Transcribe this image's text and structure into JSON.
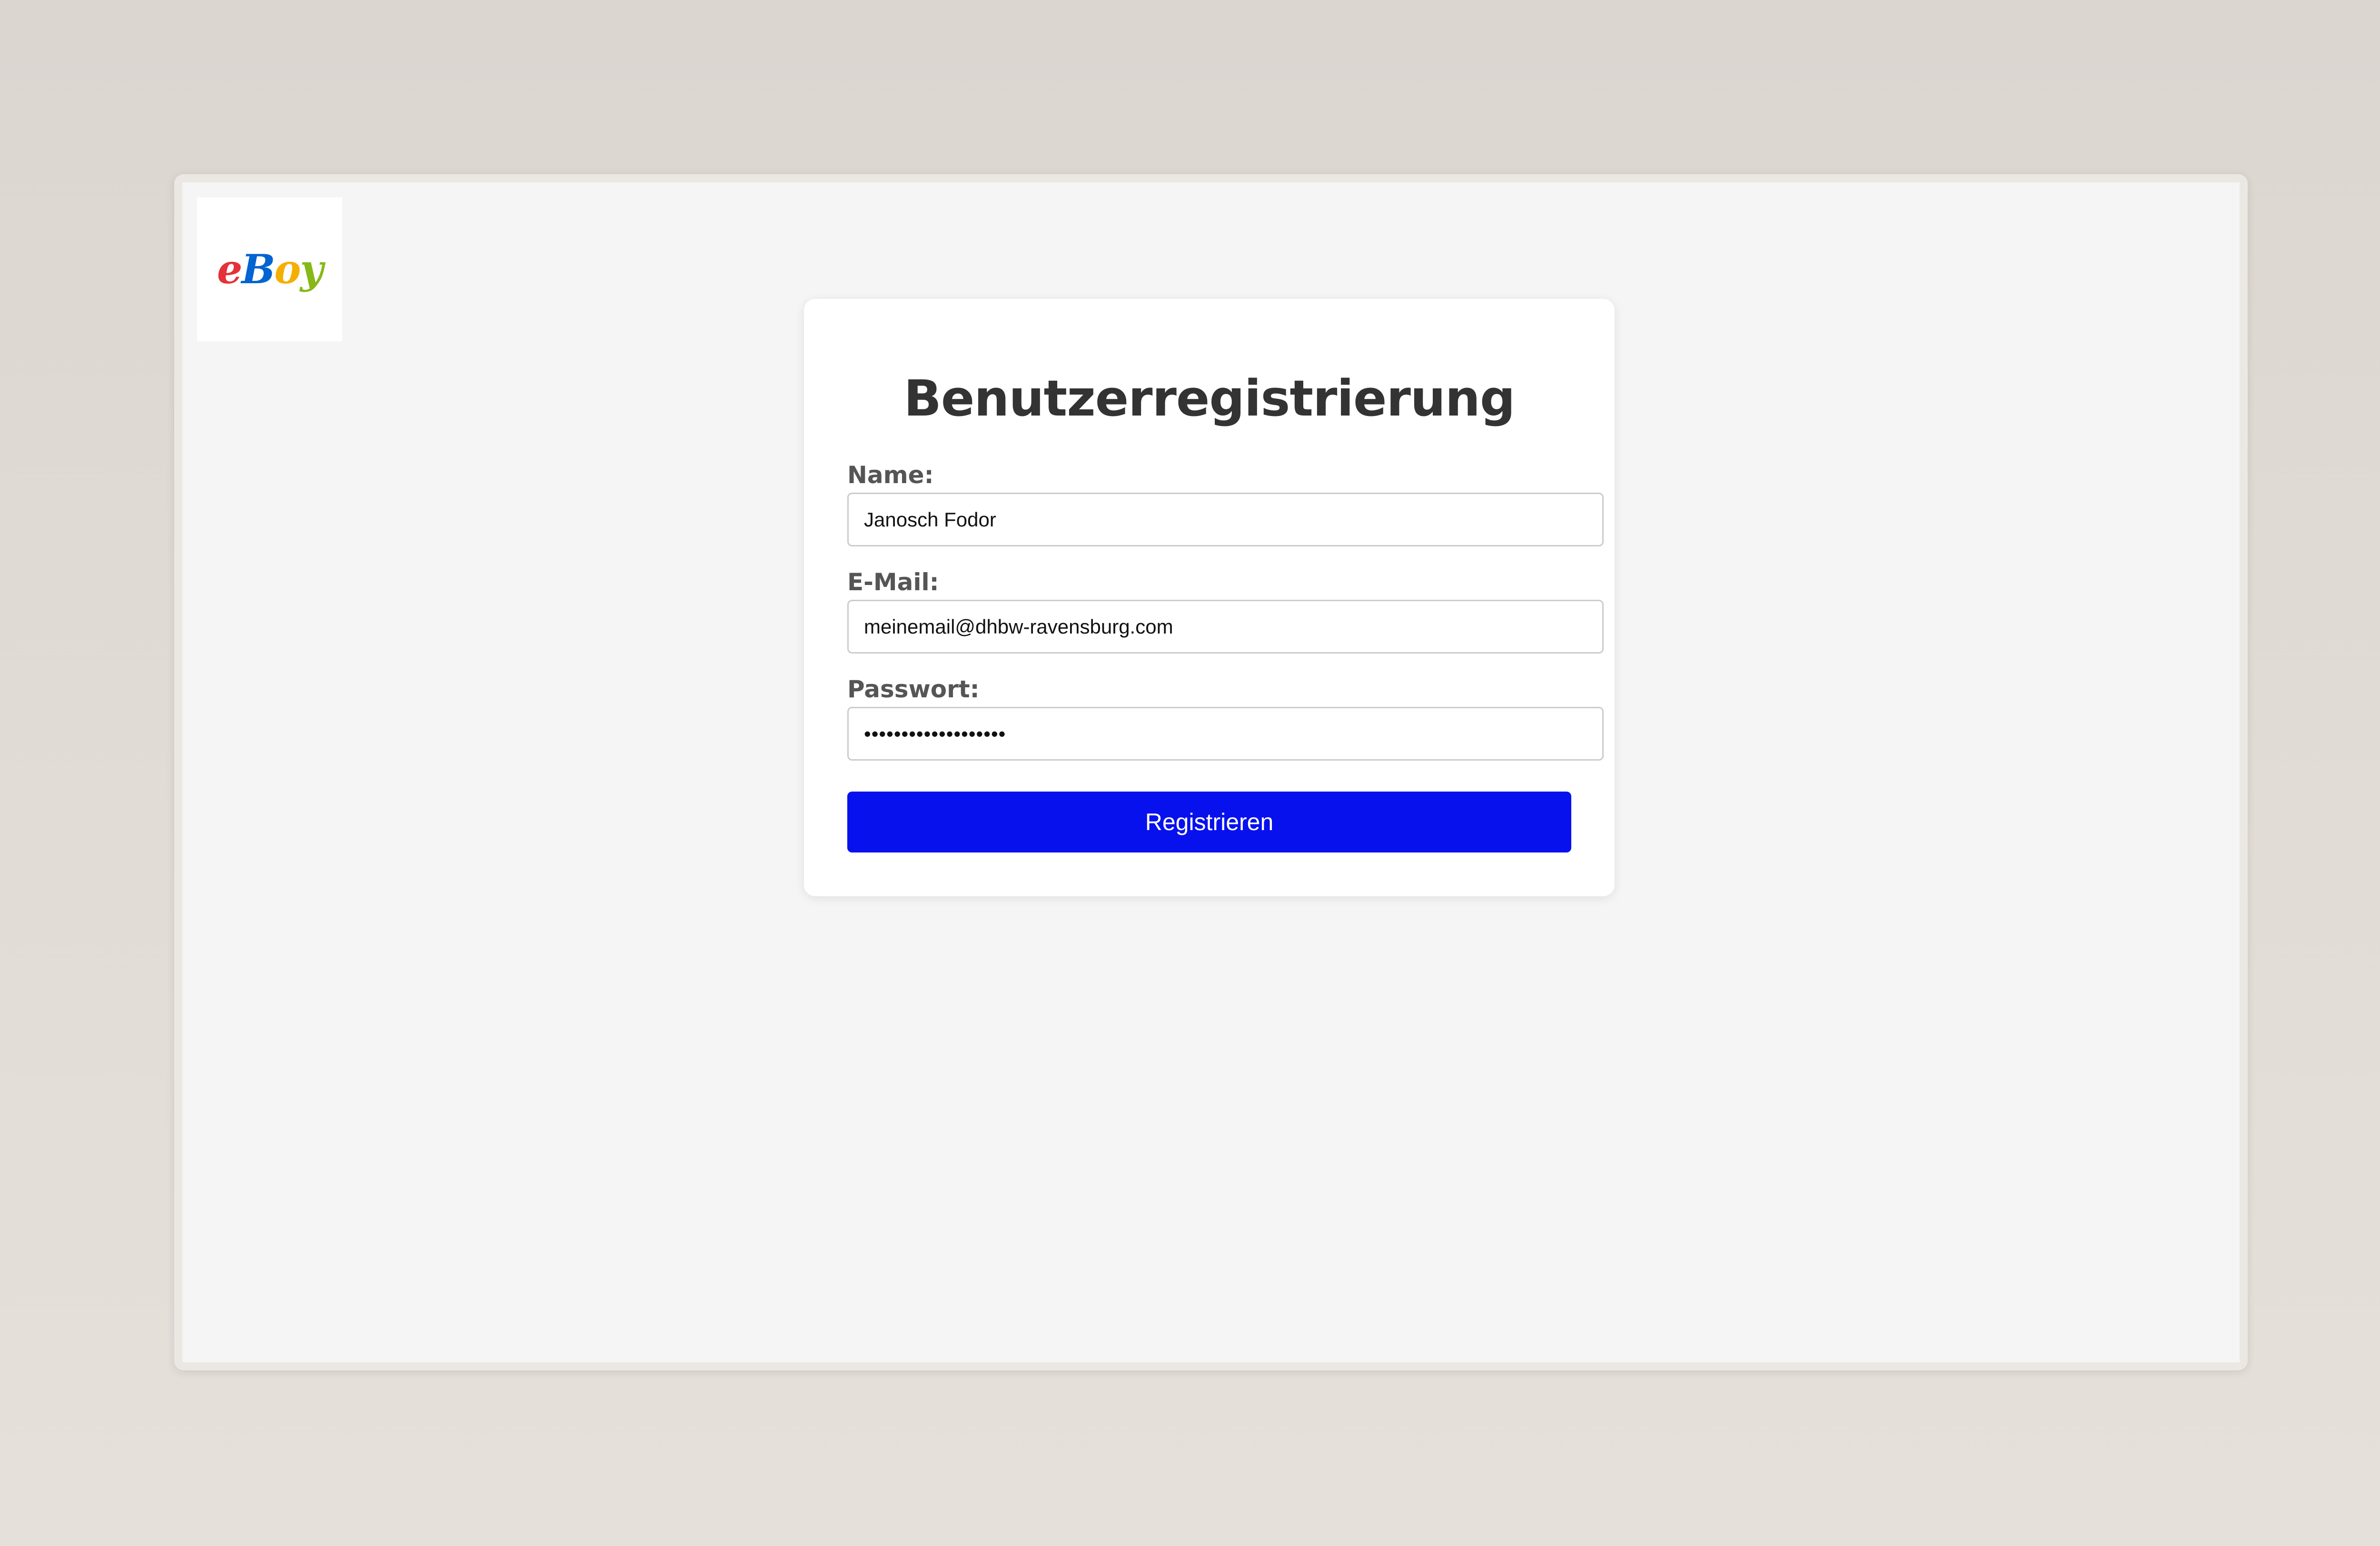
{
  "logo": {
    "letters": [
      "e",
      "B",
      "o",
      "y"
    ],
    "colors": [
      "#e53238",
      "#0064d2",
      "#f5af02",
      "#86b817"
    ]
  },
  "form": {
    "title": "Benutzerregistrierung",
    "name": {
      "label": "Name:",
      "value": "Janosch Fodor"
    },
    "email": {
      "label": "E-Mail:",
      "value": "meinemail@dhbw-ravensburg.com"
    },
    "password": {
      "label": "Passwort:",
      "value": "•••••••••••••••••••"
    },
    "submit_label": "Registrieren"
  },
  "colors": {
    "button": "#0711ee",
    "background": "#f5f5f5",
    "title": "#333333"
  }
}
